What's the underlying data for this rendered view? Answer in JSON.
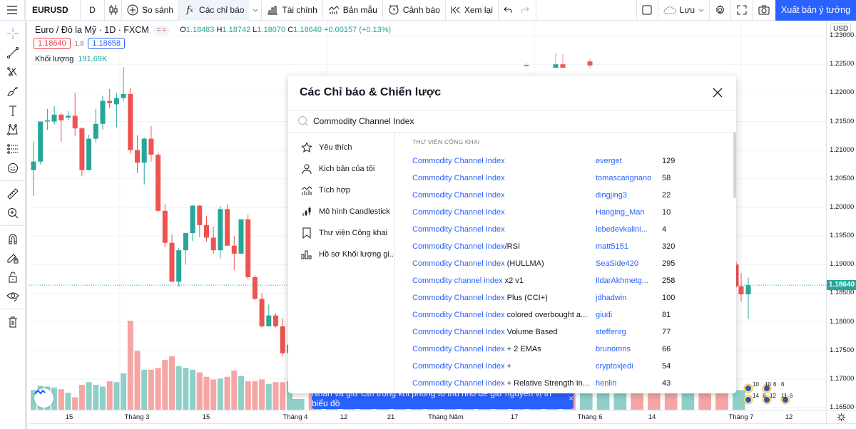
{
  "toolbar": {
    "symbol": "EURUSD",
    "interval": "D",
    "compare_label": "So sánh",
    "indicators_label": "Các chỉ báo",
    "financials_label": "Tài chính",
    "templates_label": "Bản mẫu",
    "alert_label": "Cảnh báo",
    "replay_label": "Xem lại",
    "save_label": "Lưu",
    "publish_label": "Xuất bản ý tưởng"
  },
  "legend": {
    "symbol_desc": "Euro / Đô la Mỹ · 1D · FXCM",
    "pill_minus": "=",
    "pill_approx": "≈",
    "open_key": "O",
    "open": "1.18483",
    "high_key": "H",
    "high": "1.18742",
    "low_key": "L",
    "low": "1.18070",
    "close_key": "C",
    "close": "1.18640",
    "change": "+0.00157 (+0.13%)",
    "sell_price": "1.18640",
    "spread": "1.8",
    "buy_price": "1.18658",
    "volume_label": "Khối lượng",
    "volume_value": "191.69K"
  },
  "price_axis": {
    "currency": "USD",
    "ticks": [
      "1.23000",
      "1.22500",
      "1.22000",
      "1.21500",
      "1.21000",
      "1.20500",
      "1.20000",
      "1.19500",
      "1.19000",
      "1.18500",
      "1.18000",
      "1.17500",
      "1.17000",
      "1.16500"
    ],
    "current_price": "1.18640"
  },
  "time_axis": {
    "ticks": [
      "15",
      "Tháng 3",
      "15",
      "Tháng 4",
      "12",
      "21",
      "Tháng Năm",
      "17",
      "Tháng 6",
      "14",
      "Tháng 7",
      "12"
    ]
  },
  "chart_data": {
    "type": "candlestick",
    "ylim": [
      1.1645,
      1.2325
    ],
    "colors": {
      "up": "#26a69a",
      "down": "#ef5350",
      "vol_up": "#8ed0c7",
      "vol_down": "#f5a5a4"
    },
    "candles_left": [
      {
        "o": 1.2065,
        "h": 1.2115,
        "l": 1.202,
        "c": 1.208
      },
      {
        "o": 1.208,
        "h": 1.215,
        "l": 1.2075,
        "c": 1.215
      },
      {
        "o": 1.215,
        "h": 1.2172,
        "l": 1.2135,
        "c": 1.2152
      },
      {
        "o": 1.215,
        "h": 1.2177,
        "l": 1.2145,
        "c": 1.2162
      },
      {
        "o": 1.2162,
        "h": 1.2165,
        "l": 1.2115,
        "c": 1.2152
      },
      {
        "o": 1.2157,
        "h": 1.2168,
        "l": 1.2152,
        "c": 1.216
      },
      {
        "o": 1.216,
        "h": 1.22,
        "l": 1.2125,
        "c": 1.2138
      },
      {
        "o": 1.2138,
        "h": 1.214,
        "l": 1.2055,
        "c": 1.2065
      },
      {
        "o": 1.2065,
        "h": 1.2127,
        "l": 1.2065,
        "c": 1.212
      },
      {
        "o": 1.212,
        "h": 1.2172,
        "l": 1.2113,
        "c": 1.2146
      },
      {
        "o": 1.2146,
        "h": 1.2195,
        "l": 1.2136,
        "c": 1.2186
      },
      {
        "o": 1.2186,
        "h": 1.2207,
        "l": 1.2173,
        "c": 1.2182
      },
      {
        "o": 1.218,
        "h": 1.22,
        "l": 1.214,
        "c": 1.2191
      },
      {
        "o": 1.2191,
        "h": 1.2245,
        "l": 1.2186,
        "c": 1.2198
      },
      {
        "o": 1.2198,
        "h": 1.2209,
        "l": 1.2094,
        "c": 1.21
      },
      {
        "o": 1.21,
        "h": 1.2126,
        "l": 1.206,
        "c": 1.2078
      },
      {
        "o": 1.2078,
        "h": 1.2122,
        "l": 1.204,
        "c": 1.212
      },
      {
        "o": 1.212,
        "h": 1.2142,
        "l": 1.208,
        "c": 1.2092
      },
      {
        "o": 1.2092,
        "h": 1.2096,
        "l": 1.1992,
        "c": 1.1994
      },
      {
        "o": 1.1994,
        "h": 1.2006,
        "l": 1.193,
        "c": 1.1938
      },
      {
        "o": 1.1938,
        "h": 1.1952,
        "l": 1.187,
        "c": 1.187
      },
      {
        "o": 1.187,
        "h": 1.1929,
        "l": 1.1861,
        "c": 1.1925
      },
      {
        "o": 1.1925,
        "h": 1.1956,
        "l": 1.19,
        "c": 1.1955
      },
      {
        "o": 1.1955,
        "h": 1.2004,
        "l": 1.1941,
        "c": 1.2003
      },
      {
        "o": 1.2003,
        "h": 1.2004,
        "l": 1.1948,
        "c": 1.1969
      },
      {
        "o": 1.1969,
        "h": 1.1985,
        "l": 1.194,
        "c": 1.1947
      },
      {
        "o": 1.1947,
        "h": 1.1966,
        "l": 1.1918,
        "c": 1.1925
      },
      {
        "o": 1.1925,
        "h": 1.2002,
        "l": 1.1911,
        "c": 1.1997
      },
      {
        "o": 1.1997,
        "h": 1.2005,
        "l": 1.1937,
        "c": 1.1933
      },
      {
        "o": 1.1933,
        "h": 1.195,
        "l": 1.189,
        "c": 1.1919
      },
      {
        "o": 1.1919,
        "h": 1.1977,
        "l": 1.1919,
        "c": 1.1979
      },
      {
        "o": 1.1979,
        "h": 1.1987,
        "l": 1.1874,
        "c": 1.1878
      },
      {
        "o": 1.1878,
        "h": 1.1882,
        "l": 1.1838,
        "c": 1.184
      },
      {
        "o": 1.184,
        "h": 1.185,
        "l": 1.179,
        "c": 1.1792
      },
      {
        "o": 1.1792,
        "h": 1.183,
        "l": 1.1792,
        "c": 1.1811
      },
      {
        "o": 1.1811,
        "h": 1.1815,
        "l": 1.179,
        "c": 1.1792
      },
      {
        "o": 1.1792,
        "h": 1.1806,
        "l": 1.174,
        "c": 1.1745
      },
      {
        "o": 1.1745,
        "h": 1.1762,
        "l": 1.173,
        "c": 1.176
      }
    ],
    "candles_right": [
      {
        "o": 1.2248,
        "h": 1.2252,
        "l": 1.2245,
        "c": 1.2249
      },
      {
        "o": 1.2244,
        "h": 1.227,
        "l": 1.2244,
        "c": 1.225
      },
      {
        "o": 1.225,
        "h": 1.2268,
        "l": 1.2244,
        "c": 1.2244
      },
      {
        "o": 1.2255,
        "h": 1.226,
        "l": 1.2243,
        "c": 1.2248
      }
    ],
    "candles_end": [
      {
        "o": 1.19,
        "h": 1.1905,
        "l": 1.186,
        "c": 1.1862
      },
      {
        "o": 1.1862,
        "h": 1.1885,
        "l": 1.1835,
        "c": 1.1848
      },
      {
        "o": 1.1848,
        "h": 1.1877,
        "l": 1.1805,
        "c": 1.1864
      }
    ],
    "volumes_left": [
      0.22,
      0.27,
      0.26,
      0.25,
      0.23,
      0.19,
      0.14,
      0.28,
      0.31,
      0.28,
      0.26,
      0.32,
      0.31,
      0.41,
      1.0,
      0.66,
      0.45,
      0.45,
      0.47,
      0.56,
      0.6,
      0.49,
      0.47,
      0.45,
      0.42,
      0.37,
      0.34,
      0.35,
      0.37,
      0.44,
      0.38,
      0.32,
      0.32,
      0.34,
      0.29,
      0.31,
      0.31,
      0.32
    ],
    "volumes_right_up": [
      true,
      false,
      false,
      true,
      false,
      false,
      true,
      true,
      false,
      true,
      false,
      true,
      true,
      false,
      true,
      true,
      false,
      true,
      true,
      true,
      false,
      false,
      false,
      true,
      false,
      false,
      true
    ],
    "volumes_right": [
      0.12,
      0.22,
      0.25,
      0.2,
      0.22,
      0.24,
      0.19,
      0.2,
      0.22,
      0.25,
      0.24,
      0.22,
      0.23,
      0.24,
      0.21,
      0.22,
      0.25,
      0.24,
      0.23,
      0.2,
      0.22,
      0.24,
      0.28,
      0.22,
      0.26,
      0.24,
      0.22
    ]
  },
  "dialog": {
    "title": "Các Chỉ báo & Chiến lược",
    "search_value": "Commodity Channel Index",
    "nav": [
      {
        "label": "Yêu thích",
        "icon": "star-icon"
      },
      {
        "label": "Kịch bản của tôi",
        "icon": "user-icon"
      },
      {
        "label": "Tích hợp",
        "icon": "builtin-chart-icon"
      },
      {
        "label": "Mô hình Candlestick",
        "icon": "candlestick-icon"
      },
      {
        "label": "Thư viện Công khai",
        "icon": "bookmark-icon"
      },
      {
        "label": "Hồ sơ Khối lượng gi...",
        "icon": "volume-profile-icon"
      }
    ],
    "list_header": "THƯ VIỆN CÔNG KHAI",
    "rows": [
      {
        "hl": "Commodity Channel Index",
        "rest": "",
        "author": "everget",
        "likes": "129"
      },
      {
        "hl": "Commodity Channel Index",
        "rest": "",
        "author": "tomascarignano",
        "likes": "58"
      },
      {
        "hl": "Commodity Channel Index",
        "rest": "",
        "author": "dingjing3",
        "likes": "22"
      },
      {
        "hl": "Commodity Channel Index",
        "rest": "",
        "author": "Hanging_Man",
        "likes": "10"
      },
      {
        "hl": "Commodity Channel Index",
        "rest": "",
        "author": "lebedevkalini...",
        "likes": "4"
      },
      {
        "hl": "Commodity Channel Index",
        "rest": "/RSI",
        "author": "matt5151",
        "likes": "320"
      },
      {
        "hl": "Commodity Channel Index",
        "rest": " (HULLMA)",
        "author": "SeaSide420",
        "likes": "295"
      },
      {
        "hl": "Commodity channel index",
        "rest": " x2 v1",
        "author": "IldarAkhmetg...",
        "likes": "258"
      },
      {
        "hl": "Commodity Channel Index",
        "rest": " Plus (CCI+)",
        "author": "jdhadwin",
        "likes": "100"
      },
      {
        "hl": "Commodity Channel Index",
        "rest": " colored overbought a...",
        "author": "giudi",
        "likes": "81"
      },
      {
        "hl": "Commodity Channel Index",
        "rest": " Volume Based",
        "author": "steffenrg",
        "likes": "77"
      },
      {
        "hl": "Commodity Channel Index",
        "rest": " + 2 EMAs",
        "author": "brunomns",
        "likes": "66"
      },
      {
        "hl": "Commodity Channel Index",
        "rest": " +",
        "author": "cryptoxjedi",
        "likes": "54"
      },
      {
        "hl": "Commodity Channel Index",
        "rest": " + Relative Strength In...",
        "author": "henlin",
        "likes": "43"
      }
    ]
  },
  "toast": {
    "text": "Nhấn và giữ Ctrl trong khi phóng to thu nhỏ để giữ nguyên vị trí biểu đồ",
    "close": "×"
  },
  "events": {
    "labels_top": [
      "10",
      "10",
      "6",
      "6"
    ],
    "labels_bottom": [
      "14",
      "8",
      "12",
      "11",
      "6"
    ]
  }
}
